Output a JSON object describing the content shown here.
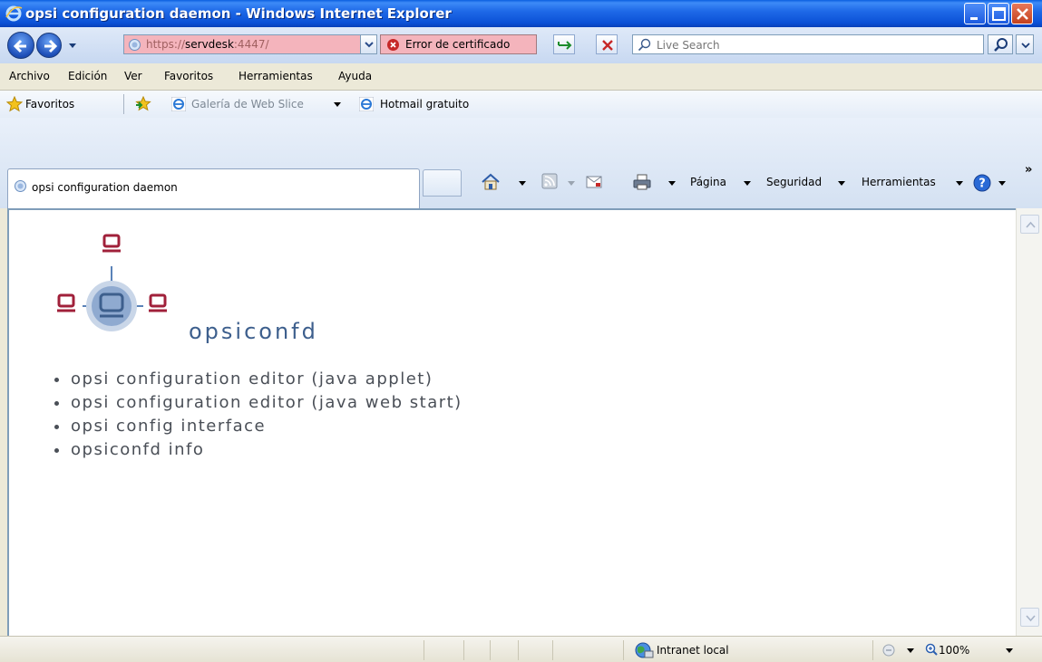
{
  "window": {
    "title": "opsi configuration daemon - Windows Internet Explorer"
  },
  "address_bar": {
    "scheme": "https://",
    "host": "servdesk",
    "port": ":4447/",
    "cert_error": "Error de certificado"
  },
  "search": {
    "placeholder": "Live Search"
  },
  "menu": {
    "items": [
      "Archivo",
      "Edición",
      "Ver",
      "Favoritos",
      "Herramientas",
      "Ayuda"
    ]
  },
  "favorites_bar": {
    "favorites_label": "Favoritos",
    "web_slice_label": "Galería de Web Slice",
    "hotmail_label": "Hotmail gratuito"
  },
  "tab": {
    "label": "opsi configuration daemon"
  },
  "command_bar": {
    "page_label": "Página",
    "safety_label": "Seguridad",
    "tools_label": "Herramientas",
    "more": "»"
  },
  "page": {
    "brand": "opsiconfd",
    "links": [
      "opsi configuration editor (java applet)",
      "opsi configuration editor (java web start)",
      "opsi config interface",
      "opsiconfd info"
    ]
  },
  "status_bar": {
    "zone": "Intranet local",
    "zoom": "100%"
  },
  "colors": {
    "titlebar": "#0b50d6",
    "cert_error_bg": "#f4b4bc",
    "brand_text": "#3d5f8d",
    "logo_red": "#a0203a",
    "logo_blue": "#5a82b8"
  }
}
